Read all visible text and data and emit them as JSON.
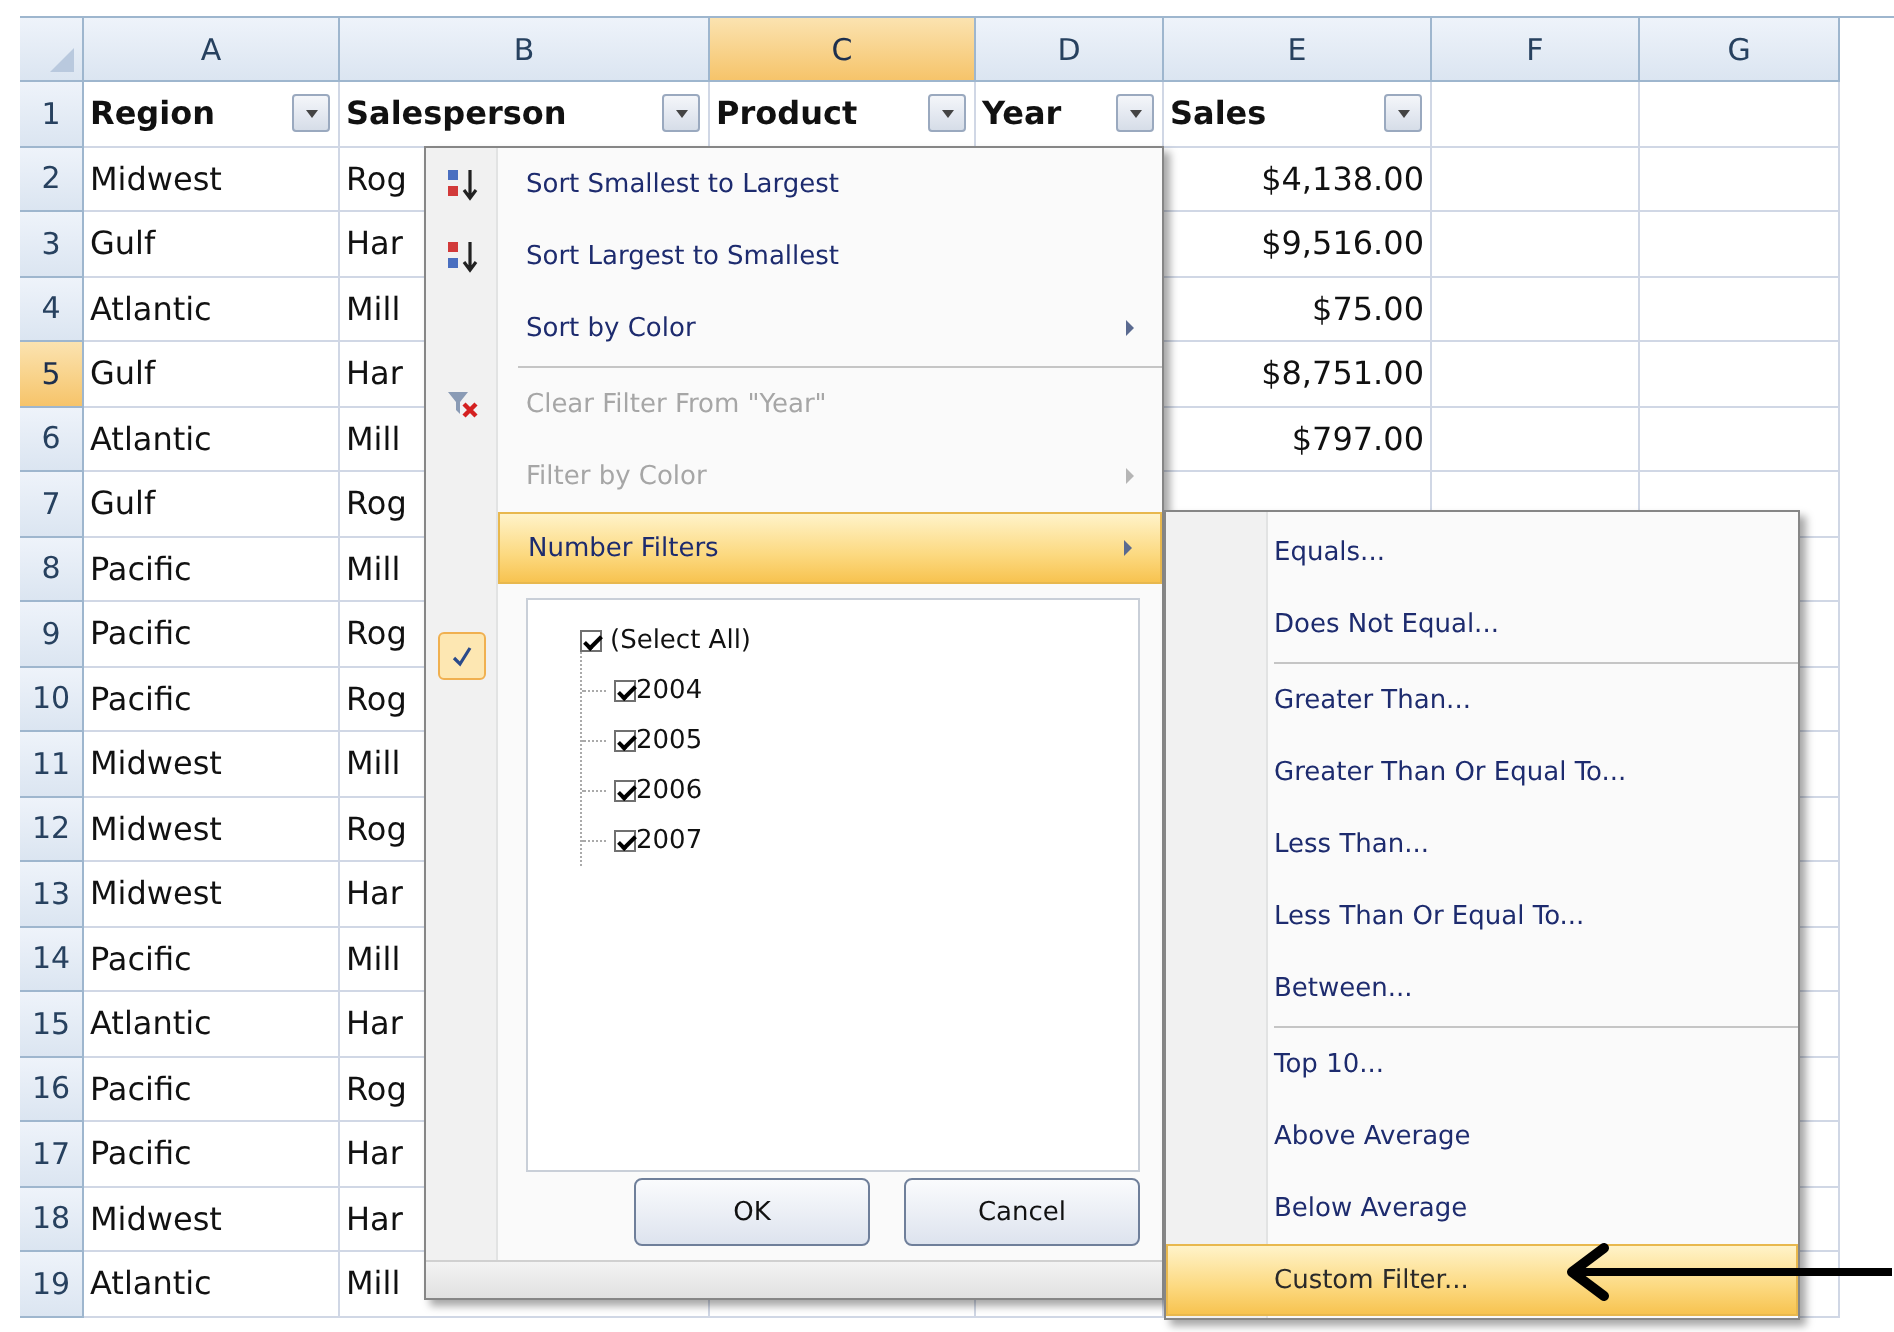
{
  "columns": [
    {
      "label": "A",
      "selected": false
    },
    {
      "label": "B",
      "selected": false
    },
    {
      "label": "C",
      "selected": true
    },
    {
      "label": "D",
      "selected": false
    },
    {
      "label": "E",
      "selected": false
    },
    {
      "label": "F",
      "selected": false
    },
    {
      "label": "G",
      "selected": false
    }
  ],
  "header_row": {
    "number": "1",
    "selected": false,
    "cells": [
      "Region",
      "Salesperson",
      "Product",
      "Year",
      "Sales"
    ]
  },
  "rows": [
    {
      "number": "2",
      "selected": false,
      "region": "Midwest",
      "salesperson": "Rog",
      "sales": "$4,138.00"
    },
    {
      "number": "3",
      "selected": false,
      "region": "Gulf",
      "salesperson": "Har",
      "sales": "$9,516.00"
    },
    {
      "number": "4",
      "selected": false,
      "region": "Atlantic",
      "salesperson": "Mill",
      "sales": "$75.00"
    },
    {
      "number": "5",
      "selected": true,
      "region": "Gulf",
      "salesperson": "Har",
      "sales": "$8,751.00"
    },
    {
      "number": "6",
      "selected": false,
      "region": "Atlantic",
      "salesperson": "Mill",
      "sales": "$797.00"
    },
    {
      "number": "7",
      "selected": false,
      "region": "Gulf",
      "salesperson": "Rog"
    },
    {
      "number": "8",
      "selected": false,
      "region": "Pacific",
      "salesperson": "Mill"
    },
    {
      "number": "9",
      "selected": false,
      "region": "Pacific",
      "salesperson": "Rog"
    },
    {
      "number": "10",
      "selected": false,
      "region": "Pacific",
      "salesperson": "Rog"
    },
    {
      "number": "11",
      "selected": false,
      "region": "Midwest",
      "salesperson": "Mill"
    },
    {
      "number": "12",
      "selected": false,
      "region": "Midwest",
      "salesperson": "Rog"
    },
    {
      "number": "13",
      "selected": false,
      "region": "Midwest",
      "salesperson": "Har"
    },
    {
      "number": "14",
      "selected": false,
      "region": "Pacific",
      "salesperson": "Mill"
    },
    {
      "number": "15",
      "selected": false,
      "region": "Atlantic",
      "salesperson": "Har"
    },
    {
      "number": "16",
      "selected": false,
      "region": "Pacific",
      "salesperson": "Rog"
    },
    {
      "number": "17",
      "selected": false,
      "region": "Pacific",
      "salesperson": "Har"
    },
    {
      "number": "18",
      "selected": false,
      "region": "Midwest",
      "salesperson": "Har"
    },
    {
      "number": "19",
      "selected": false,
      "region": "Atlantic",
      "salesperson": "Mill"
    }
  ],
  "filter_menu": {
    "items": [
      {
        "label": "Sort Smallest to Largest",
        "kind": "sort_ascending",
        "disabled": false,
        "submenu": false,
        "selected": false,
        "divider_above": false
      },
      {
        "label": "Sort Largest to Smallest",
        "kind": "sort_descending",
        "disabled": false,
        "submenu": false,
        "selected": false,
        "divider_above": false
      },
      {
        "label": "Sort by Color",
        "kind": "plain",
        "disabled": false,
        "submenu": true,
        "selected": false,
        "divider_above": false
      },
      {
        "label": "Clear Filter From \"Year\"",
        "kind": "clear_filter",
        "disabled": true,
        "submenu": false,
        "selected": false,
        "divider_above": true
      },
      {
        "label": "Filter by Color",
        "kind": "plain",
        "disabled": true,
        "submenu": true,
        "selected": false,
        "divider_above": false
      },
      {
        "label": "Number Filters",
        "kind": "plain",
        "disabled": false,
        "submenu": true,
        "selected": true,
        "divider_above": false
      }
    ],
    "values": [
      {
        "label": "(Select All)",
        "checked": true,
        "children": [
          {
            "label": "2004",
            "checked": true
          },
          {
            "label": "2005",
            "checked": true
          },
          {
            "label": "2006",
            "checked": true
          },
          {
            "label": "2007",
            "checked": true
          }
        ]
      }
    ],
    "buttons": [
      "OK",
      "Cancel"
    ]
  },
  "number_filters_menu": {
    "items": [
      {
        "label": "Equals...",
        "selected": false,
        "divider_above": false
      },
      {
        "label": "Does Not Equal...",
        "selected": false,
        "divider_above": false
      },
      {
        "label": "Greater Than...",
        "selected": false,
        "divider_above": true
      },
      {
        "label": "Greater Than Or Equal To...",
        "selected": false,
        "divider_above": false
      },
      {
        "label": "Less Than...",
        "selected": false,
        "divider_above": false
      },
      {
        "label": "Less Than Or Equal To...",
        "selected": false,
        "divider_above": false
      },
      {
        "label": "Between...",
        "selected": false,
        "divider_above": false
      },
      {
        "label": "Top 10...",
        "selected": false,
        "divider_above": true
      },
      {
        "label": "Above Average",
        "selected": false,
        "divider_above": false
      },
      {
        "label": "Below Average",
        "selected": false,
        "divider_above": false
      },
      {
        "label": "Custom Filter...",
        "selected": true,
        "divider_above": false
      }
    ]
  }
}
